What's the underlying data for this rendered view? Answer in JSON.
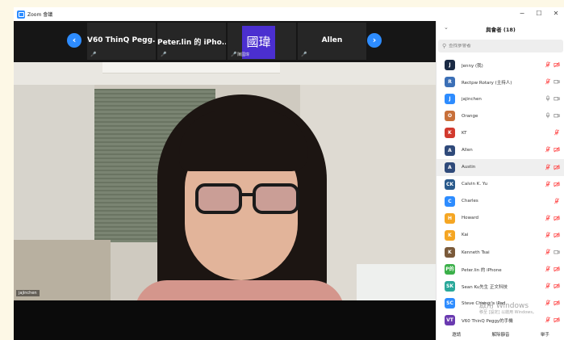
{
  "window": {
    "title": "Zoom 會議",
    "buttons": {
      "minimize": "−",
      "maximize": "☐",
      "close": "✕"
    }
  },
  "video_strip": {
    "prev": "‹",
    "next": "›",
    "thumbnails": [
      {
        "name": "V60 ThinQ Pegg...",
        "mic": "🎤"
      },
      {
        "name": "Peter.lin 的 iPho...",
        "mic": "🎤"
      },
      {
        "avatar": "國瑋",
        "sub": "陳國瑋",
        "mic": "🎤"
      },
      {
        "name": "Allen",
        "mic": "🎤"
      }
    ]
  },
  "main_video": {
    "self_label": "jajinchen"
  },
  "panel": {
    "title": "與會者 (18)",
    "search_placeholder": "查找參會者",
    "participants": [
      {
        "name": "Jenny (我)",
        "initials": "J",
        "color": "#1a2a44",
        "mic": "muted",
        "video": "muted"
      },
      {
        "name": "Rectpw Rotary (主持人)",
        "initials": "R",
        "color": "#3b6fb6",
        "mic": "muted",
        "video": "off"
      },
      {
        "name": "jajinchen",
        "initials": "J",
        "color": "#2d8cff",
        "mic": "on",
        "video": "off"
      },
      {
        "name": "Orange",
        "initials": "O",
        "color": "#c8703a",
        "mic": "on",
        "video": "off"
      },
      {
        "name": "KT",
        "initials": "K",
        "color": "#d23a2e",
        "mic": "muted",
        "video": "none"
      },
      {
        "name": "Allen",
        "initials": "A",
        "color": "#2f4a7a",
        "mic": "muted",
        "video": "muted"
      },
      {
        "name": "Austin",
        "initials": "A",
        "color": "#2f4a7a",
        "mic": "muted",
        "video": "muted"
      },
      {
        "name": "Calvin K. Yu",
        "initials": "CK",
        "color": "#2a5a8c",
        "mic": "muted",
        "video": "muted"
      },
      {
        "name": "Charles",
        "initials": "C",
        "color": "#2d8cff",
        "mic": "muted",
        "video": "none"
      },
      {
        "name": "Howard",
        "initials": "H",
        "color": "#f5a623",
        "mic": "muted",
        "video": "muted"
      },
      {
        "name": "Kai",
        "initials": "K",
        "color": "#f5a623",
        "mic": "muted",
        "video": "muted"
      },
      {
        "name": "Kenneth Tsai",
        "initials": "K",
        "color": "#7a5a3a",
        "mic": "muted",
        "video": "off"
      },
      {
        "name": "Peter.lin 的 iPhone",
        "initials": "P的",
        "color": "#3bb04a",
        "mic": "muted",
        "video": "muted"
      },
      {
        "name": "Sean Ku先生 正文科技",
        "initials": "SK",
        "color": "#2aa89a",
        "mic": "muted",
        "video": "muted"
      },
      {
        "name": "Steve Chang 's iPad",
        "initials": "SC",
        "color": "#2d8cff",
        "mic": "muted",
        "video": "muted"
      },
      {
        "name": "V60 ThinQ Peggy的手機",
        "initials": "VT",
        "color": "#6a3ab0",
        "mic": "muted",
        "video": "muted"
      }
    ],
    "footer": {
      "invite": "邀請",
      "unmute": "解除靜音",
      "raise_hand": "舉手"
    }
  },
  "watermark": {
    "line1": "啟用 Windows",
    "line2": "移至 [設定] 以啟用 Windows。"
  },
  "colors": {
    "accent": "#2d8cff",
    "muted_red": "#ff4b4b",
    "avatar_purple": "#4b2fd0"
  }
}
